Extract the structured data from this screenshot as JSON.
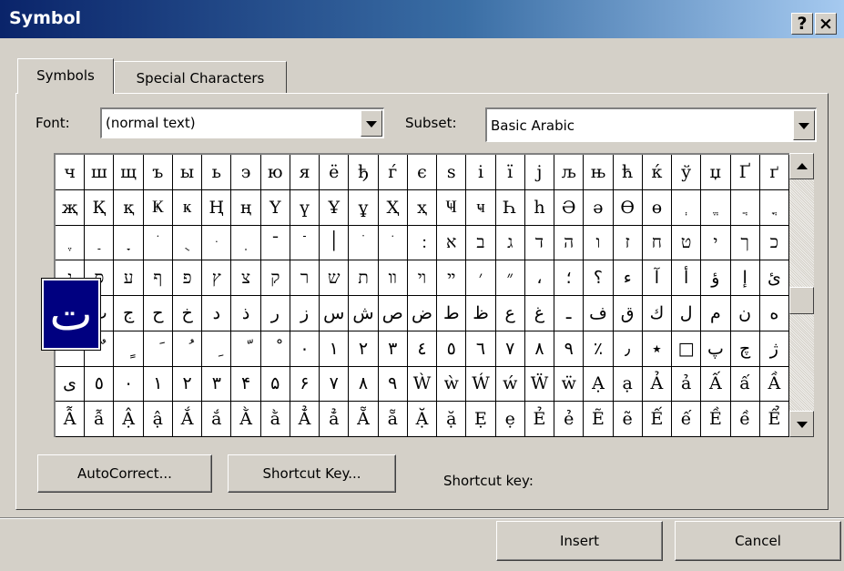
{
  "window": {
    "title": "Symbol",
    "help_glyph": "?",
    "close_glyph": "×"
  },
  "tabs": [
    {
      "label": "Symbols",
      "active": true
    },
    {
      "label": "Special Characters",
      "active": false
    }
  ],
  "font": {
    "label": "Font:",
    "value": "(normal text)"
  },
  "subset": {
    "label": "Subset:",
    "value": "Basic Arabic"
  },
  "grid_rows": [
    [
      "ч",
      "ш",
      "щ",
      "ъ",
      "ы",
      "ь",
      "э",
      "ю",
      "я",
      "ё",
      "ђ",
      "ѓ",
      "є",
      "ѕ",
      "і",
      "ї",
      "ј",
      "љ",
      "њ",
      "ћ",
      "ќ",
      "ў",
      "џ",
      "Ґ",
      "ґ",
      "Ғ",
      "ғ",
      "Җ"
    ],
    [
      "җ",
      "Қ",
      "қ",
      "Ҝ",
      "ҝ",
      "Ң",
      "ң",
      "Ү",
      "ү",
      "Ұ",
      "ұ",
      "Ҳ",
      "ҳ",
      "Ҹ",
      "ҹ",
      "Һ",
      "һ",
      "Ә",
      "ә",
      "Ө",
      "ө",
      "ְ",
      "ֱ",
      "ֲ",
      "ֳ",
      "ִ",
      "ֵ"
    ],
    [
      "ֶ",
      "ַ",
      "ָ",
      "ֹ",
      "ֻ",
      "ּ",
      "ֽ",
      "־",
      "ֿ",
      "׀",
      "ׁ",
      "ׂ",
      "׃",
      "א",
      "ב",
      "ג",
      "ד",
      "ה",
      "ו",
      "ז",
      "ח",
      "ט",
      "י",
      "ך",
      "כ",
      "ל",
      "ם",
      "מ",
      "ן"
    ],
    [
      "נ",
      "ס",
      "ע",
      "ף",
      "פ",
      "ץ",
      "צ",
      "ק",
      "ר",
      "ש",
      "ת",
      "װ",
      "ױ",
      "ײ",
      "׳",
      "״",
      "،",
      "؛",
      "؟",
      "ء",
      "آ",
      "أ",
      "ؤ",
      "إ",
      "ئ",
      "ا",
      "ب",
      "ة"
    ],
    [
      "ت",
      "ث",
      "ج",
      "ح",
      "خ",
      "د",
      "ذ",
      "ر",
      "ز",
      "س",
      "ش",
      "ص",
      "ض",
      "ط",
      "ظ",
      "ع",
      "غ",
      "ـ",
      "ف",
      "ق",
      "ك",
      "ل",
      "م",
      "ن",
      "ه",
      "و",
      "ى",
      "ي"
    ],
    [
      "ً",
      "ٌ",
      "ٍ",
      "َ",
      "ُ",
      "ِ",
      "ّ",
      "ْ",
      "٠",
      "١",
      "٢",
      "٣",
      "٤",
      "٥",
      "٦",
      "٧",
      "٨",
      "٩",
      "٪",
      "٫",
      "٭",
      "□",
      "پ",
      "چ",
      "ژ",
      "□",
      "ک",
      "گ"
    ],
    [
      "ی",
      "٥",
      "٠",
      "١",
      "٢",
      "٣",
      "۴",
      "۵",
      "۶",
      "٧",
      "٨",
      "٩",
      "Ẁ",
      "ẁ",
      "Ẃ",
      "ẃ",
      "Ẅ",
      "ẅ",
      "Ạ",
      "ạ",
      "Ả",
      "ả",
      "Ấ",
      "ấ",
      "Ầ",
      "ầ",
      "Ẩ",
      "ẩ"
    ],
    [
      "Ẫ",
      "ẫ",
      "Ậ",
      "ậ",
      "Ắ",
      "ắ",
      "Ằ",
      "ằ",
      "Ẳ",
      "ẳ",
      "Ẵ",
      "ẵ",
      "Ặ",
      "ặ",
      "Ẹ",
      "ẹ",
      "Ẻ",
      "ẻ",
      "Ẽ",
      "ẽ",
      "Ế",
      "ế",
      "Ề",
      "ề",
      "Ể",
      "ể",
      "Ễ",
      "ễ"
    ]
  ],
  "preview_char": "ت",
  "buttons": {
    "autocorrect": "AutoCorrect...",
    "shortcut_key": "Shortcut Key...",
    "insert": "Insert",
    "cancel": "Cancel"
  },
  "shortcut_label": "Shortcut key:",
  "colors": {
    "title_start": "#0a246a",
    "title_end": "#a6caf0",
    "selection": "#000080",
    "face": "#d4d0c8"
  },
  "icons": [
    "help-icon",
    "close-icon",
    "dropdown-arrow-icon",
    "scroll-up-icon",
    "scroll-down-icon"
  ]
}
